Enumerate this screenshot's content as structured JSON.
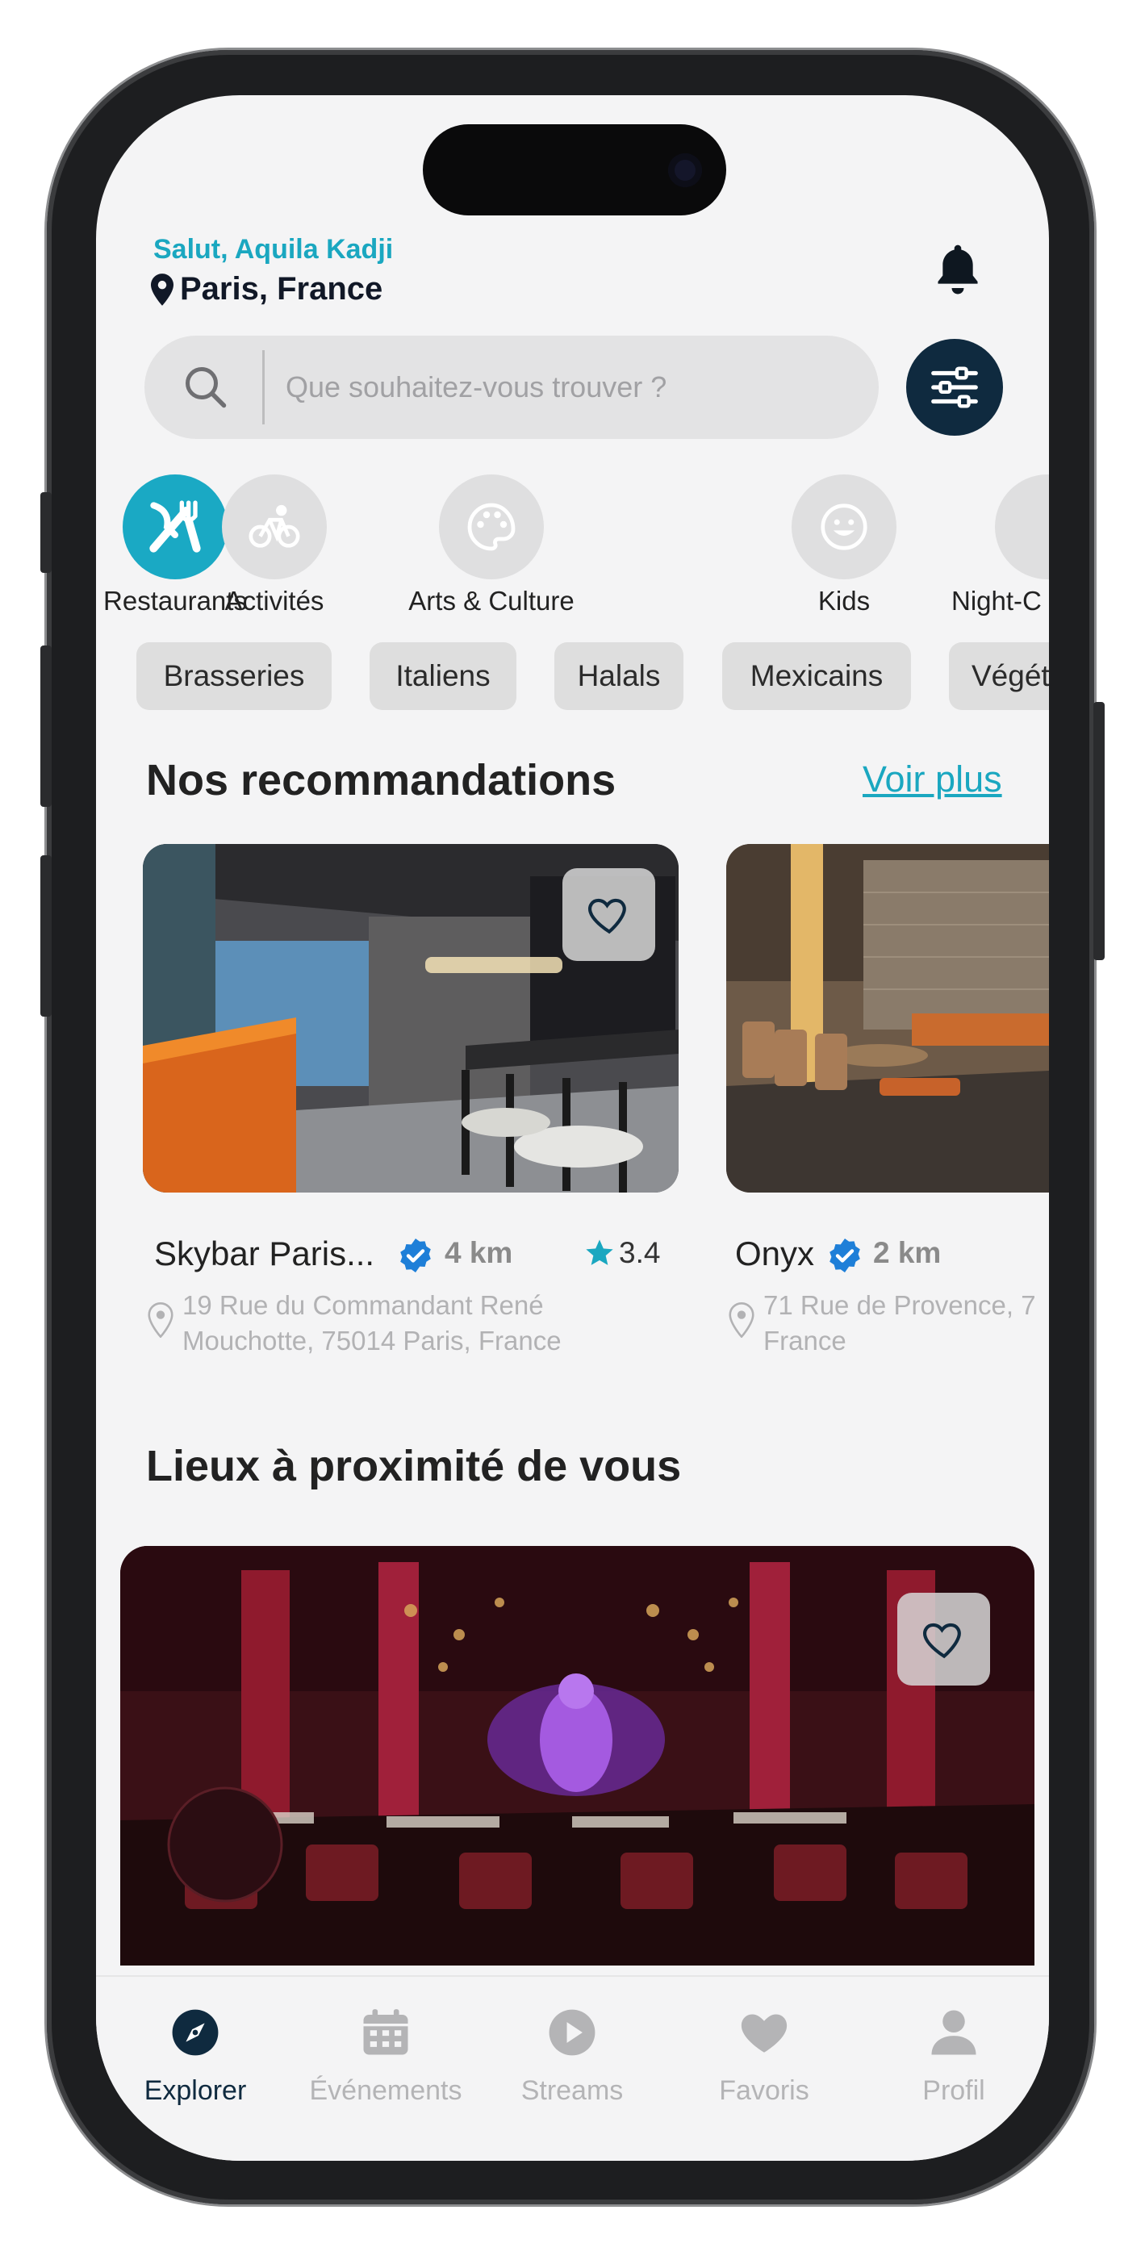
{
  "header": {
    "greeting": "Salut, Aquila Kadji",
    "location": "Paris, France"
  },
  "search": {
    "placeholder": "Que souhaitez-vous trouver ?"
  },
  "categories": [
    {
      "label": "Restaurants",
      "icon": "fork-knife-icon",
      "active": true
    },
    {
      "label": "Activités",
      "icon": "bike-icon",
      "active": false
    },
    {
      "label": "Arts & Culture",
      "icon": "palette-icon",
      "active": false
    },
    {
      "label": "Kids",
      "icon": "smile-icon",
      "active": false
    },
    {
      "label": "Night-C",
      "icon": "moon-icon",
      "active": false
    }
  ],
  "chips": [
    "Brasseries",
    "Italiens",
    "Halals",
    "Mexicains",
    "Végét"
  ],
  "recommendations": {
    "title": "Nos recommandations",
    "more": "Voir plus",
    "cards": [
      {
        "name": "Skybar Paris...",
        "distance": "4 km",
        "rating": "3.4",
        "address_line1": "19 Rue du Commandant René",
        "address_line2": "Mouchotte, 75014 Paris, France"
      },
      {
        "name": "Onyx",
        "distance": "2 km",
        "address_line1": "71 Rue de Provence, 7",
        "address_line2": "France"
      }
    ]
  },
  "nearby": {
    "title": "Lieux à proximité de vous"
  },
  "tabs": [
    {
      "label": "Explorer",
      "icon": "compass-icon",
      "active": true
    },
    {
      "label": "Événements",
      "icon": "calendar-icon",
      "active": false
    },
    {
      "label": "Streams",
      "icon": "play-icon",
      "active": false
    },
    {
      "label": "Favoris",
      "icon": "heart-icon",
      "active": false
    },
    {
      "label": "Profil",
      "icon": "user-icon",
      "active": false
    }
  ],
  "colors": {
    "accent": "#1aa7c0",
    "navy": "#0f2a3f",
    "background": "#f4f4f5"
  }
}
